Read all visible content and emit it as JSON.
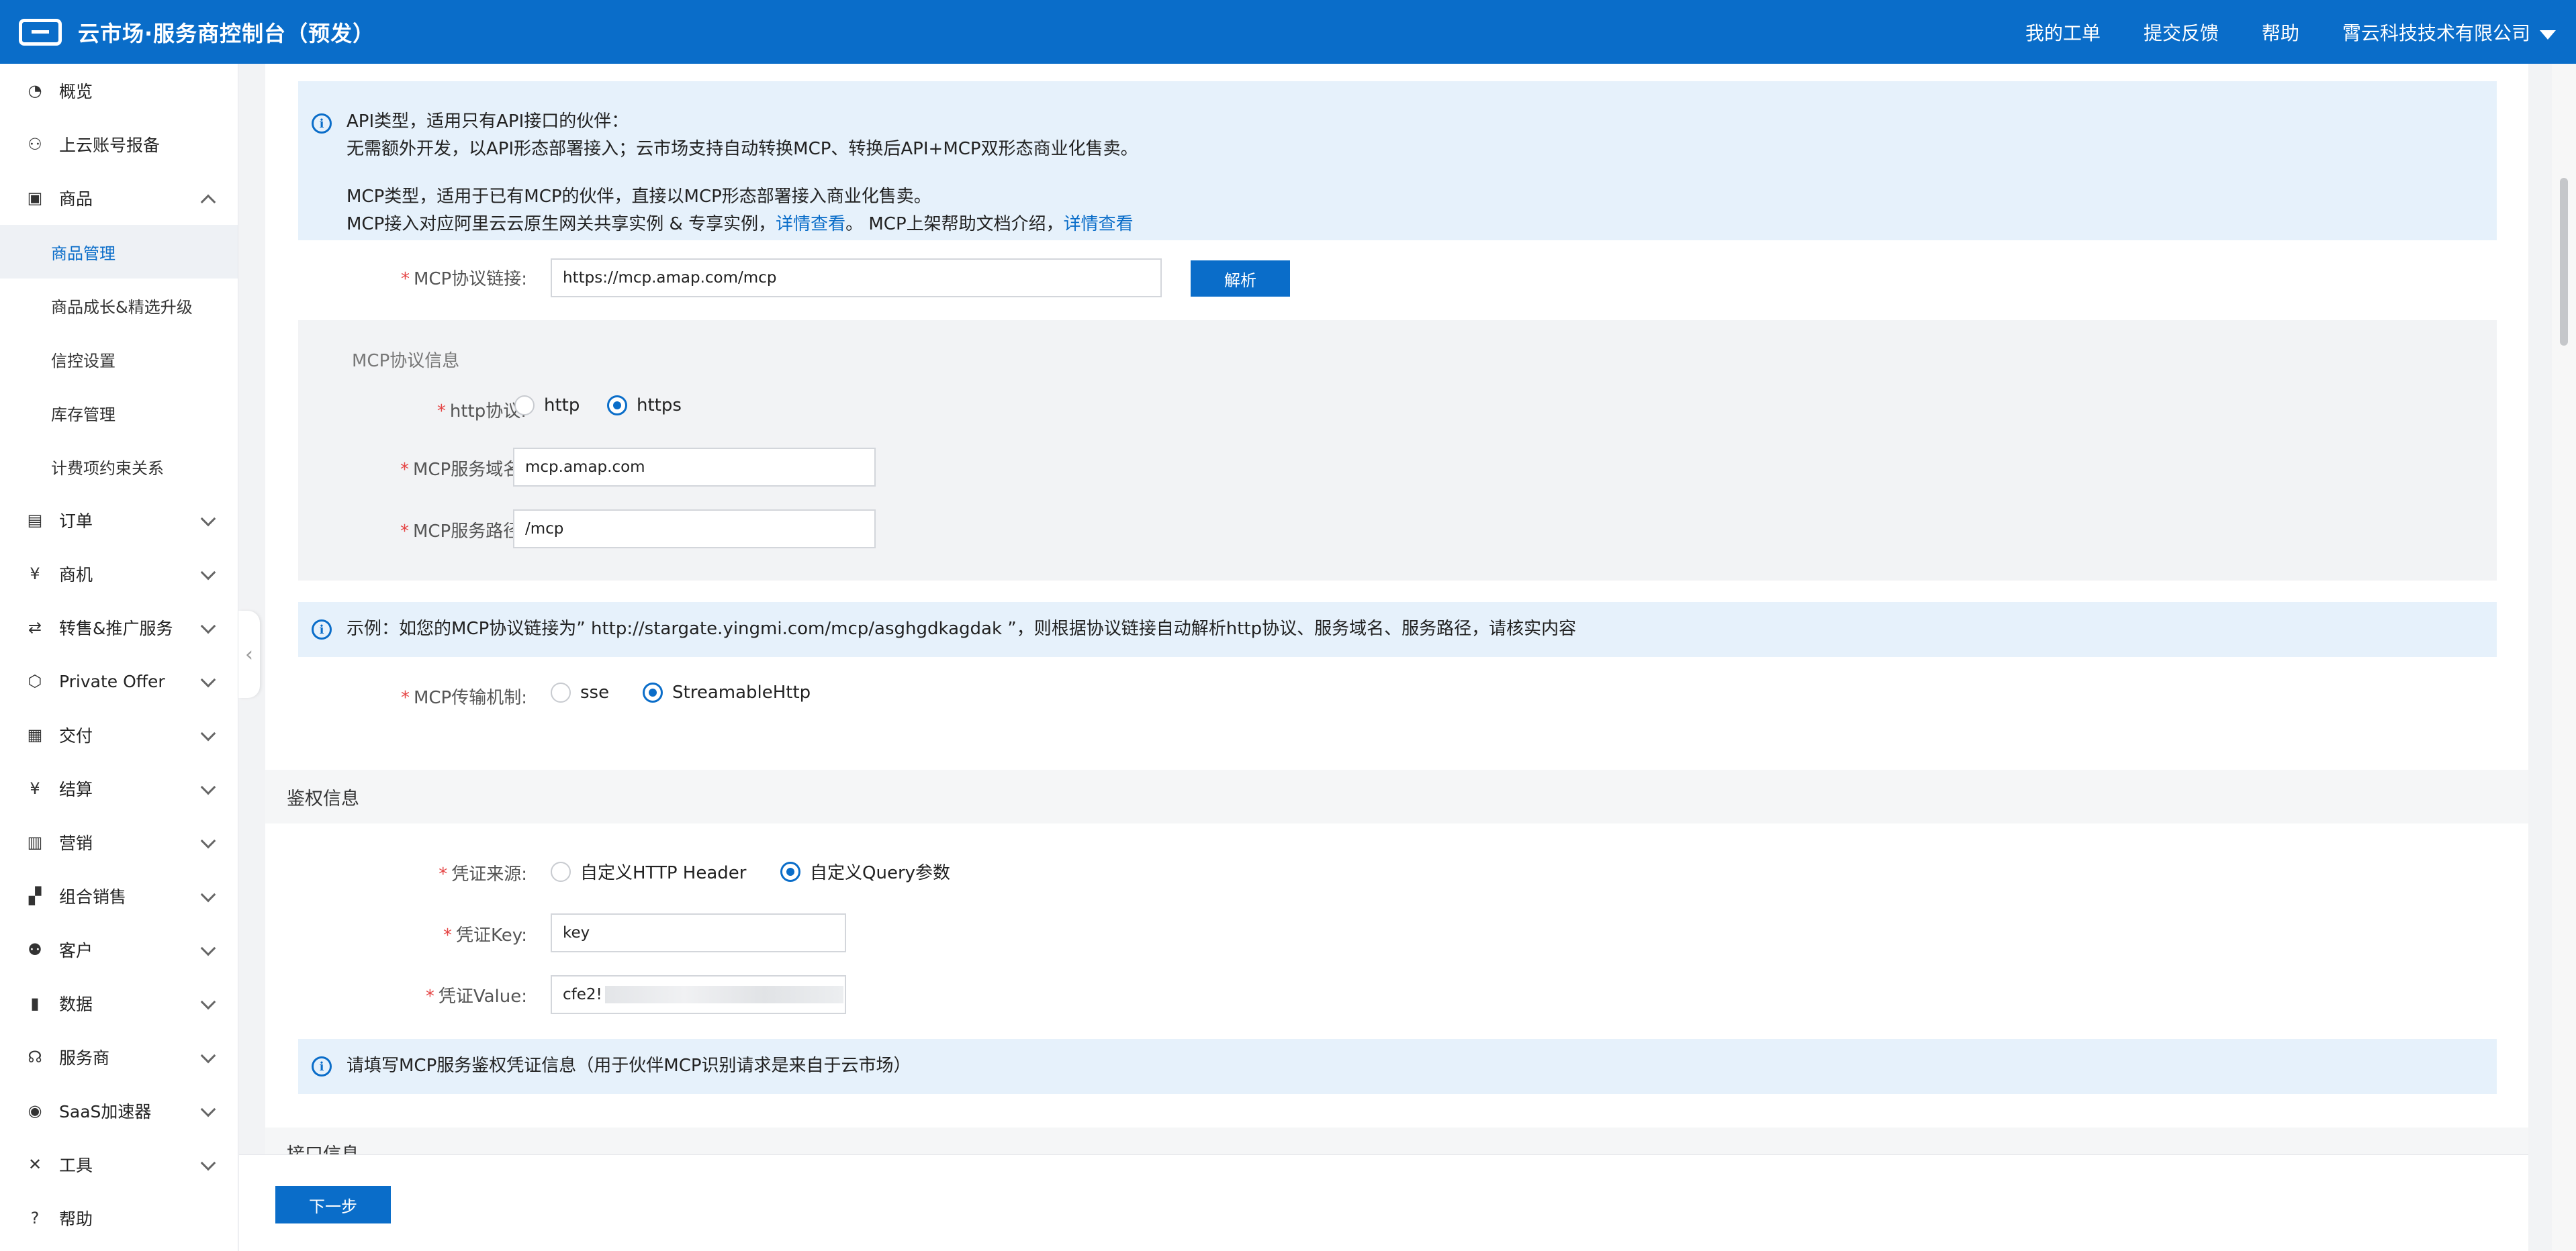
{
  "header": {
    "title": "云市场·服务商控制台（预发）",
    "nav": [
      "我的工单",
      "提交反馈",
      "帮助",
      "霄云科技技术有限公司"
    ]
  },
  "sidebar": {
    "items": [
      {
        "label": "概览",
        "icon": "pie-chart-icon"
      },
      {
        "label": "上云账号报备",
        "icon": "user-icon"
      },
      {
        "label": "商品",
        "icon": "bag-icon",
        "expanded": true
      },
      {
        "label": "商品管理",
        "sub": true,
        "active": true
      },
      {
        "label": "商品成长&精选升级",
        "sub": true
      },
      {
        "label": "信控设置",
        "sub": true
      },
      {
        "label": "库存管理",
        "sub": true
      },
      {
        "label": "计费项约束关系",
        "sub": true
      },
      {
        "label": "订单",
        "icon": "order-icon"
      },
      {
        "label": "商机",
        "icon": "opportunity-icon"
      },
      {
        "label": "转售&推广服务",
        "icon": "transfer-icon"
      },
      {
        "label": "Private Offer",
        "icon": "cube-icon"
      },
      {
        "label": "交付",
        "icon": "delivery-icon"
      },
      {
        "label": "结算",
        "icon": "yen-icon"
      },
      {
        "label": "营销",
        "icon": "marketing-icon"
      },
      {
        "label": "组合销售",
        "icon": "bundle-icon"
      },
      {
        "label": "客户",
        "icon": "customers-icon"
      },
      {
        "label": "数据",
        "icon": "data-icon"
      },
      {
        "label": "服务商",
        "icon": "headset-icon"
      },
      {
        "label": "SaaS加速器",
        "icon": "accelerator-icon"
      },
      {
        "label": "工具",
        "icon": "tools-icon"
      },
      {
        "label": "帮助",
        "icon": "help-icon"
      }
    ]
  },
  "notice_top": {
    "line1": "API类型，适用只有API接口的伙伴：",
    "line2": "无需额外开发，以API形态部署接入；云市场支持自动转换MCP、转换后API+MCP双形态商业化售卖。",
    "line3": "MCP类型，适用于已有MCP的伙伴，直接以MCP形态部署接入商业化售卖。",
    "line4_a": "MCP接入对应阿里云云原生网关共享实例 & 专享实例，",
    "link1": "详情查看",
    "line4_b": "。 MCP上架帮助文档介绍，",
    "link2": "详情查看"
  },
  "form": {
    "mcp_link_label": "MCP协议链接:",
    "mcp_link_value": "https://mcp.amap.com/mcp",
    "parse_button": "解析",
    "panel_title": "MCP协议信息",
    "http_label": "http协议:",
    "http_options": [
      "http",
      "https"
    ],
    "http_selected": "https",
    "domain_label": "MCP服务域名:",
    "domain_value": "mcp.amap.com",
    "path_label": "MCP服务路径:",
    "path_value": "/mcp",
    "example_notice": "示例：如您的MCP协议链接为” http://stargate.yingmi.com/mcp/asghgdkagdak ”，则根据协议链接自动解析http协议、服务域名、服务路径，请核实内容",
    "transport_label": "MCP传输机制:",
    "transport_options": [
      "sse",
      "StreamableHttp"
    ],
    "transport_selected": "StreamableHttp"
  },
  "auth": {
    "section_title": "鉴权信息",
    "source_label": "凭证来源:",
    "source_options": [
      "自定义HTTP Header",
      "自定义Query参数"
    ],
    "source_selected": "自定义Query参数",
    "key_label": "凭证Key:",
    "key_value": "key",
    "value_label": "凭证Value:",
    "value_prefix": "cfe2!",
    "notice": "请填写MCP服务鉴权凭证信息（用于伙伴MCP识别请求是来自于云市场）"
  },
  "interface_section_title": "接口信息",
  "footer": {
    "next_button": "下一步"
  }
}
